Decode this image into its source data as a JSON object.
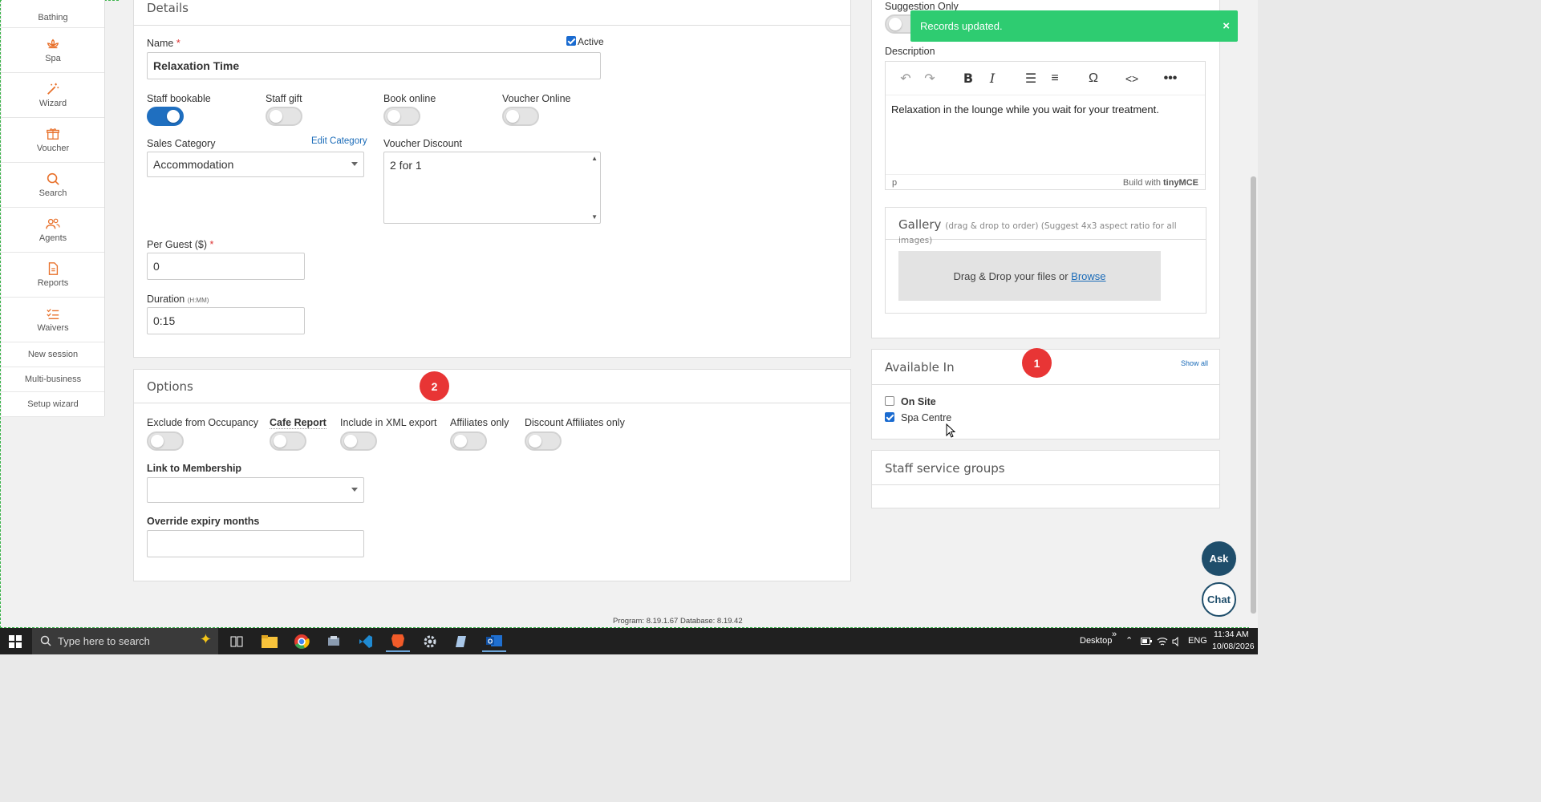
{
  "sidebar": {
    "items": [
      {
        "label": "Bathing",
        "icon": "bathing-icon"
      },
      {
        "label": "Spa",
        "icon": "lotus-icon"
      },
      {
        "label": "Wizard",
        "icon": "magic-wand-icon"
      },
      {
        "label": "Voucher",
        "icon": "gift-icon"
      },
      {
        "label": "Search",
        "icon": "search-icon"
      },
      {
        "label": "Agents",
        "icon": "users-icon"
      },
      {
        "label": "Reports",
        "icon": "document-icon"
      },
      {
        "label": "Waivers",
        "icon": "checklist-icon"
      }
    ],
    "links": [
      "New session",
      "Multi-business",
      "Setup wizard"
    ]
  },
  "details": {
    "title": "Details",
    "name_label": "Name",
    "required_mark": "*",
    "active_label": "Active",
    "active_checked": true,
    "name_value": "Relaxation Time",
    "toggles": [
      {
        "label": "Staff bookable",
        "on": true
      },
      {
        "label": "Staff gift",
        "on": false
      },
      {
        "label": "Book online",
        "on": false
      },
      {
        "label": "Voucher Online",
        "on": false
      }
    ],
    "sales_category_label": "Sales Category",
    "edit_category_label": "Edit Category",
    "sales_category_value": "Accommodation",
    "voucher_discount_label": "Voucher Discount",
    "voucher_discount_value": "2 for 1",
    "per_guest_label": "Per Guest ($)",
    "per_guest_value": "0",
    "duration_label": "Duration",
    "duration_hint": "(H:MM)",
    "duration_value": "0:15"
  },
  "options": {
    "title": "Options",
    "badge": "2",
    "toggles": [
      {
        "label": "Exclude from Occupancy",
        "on": false
      },
      {
        "label": "Cafe Report",
        "on": false
      },
      {
        "label": "Include in XML export",
        "on": false
      },
      {
        "label": "Affiliates only",
        "on": false
      },
      {
        "label": "Discount Affiliates only",
        "on": false
      }
    ],
    "membership_label": "Link to Membership",
    "membership_value": "",
    "expiry_label": "Override expiry months",
    "expiry_value": ""
  },
  "right": {
    "suggestion_label": "Suggestion Only",
    "toast": "Records updated.",
    "toast_close": "×",
    "description_label": "Description",
    "description_text": "Relaxation in the lounge while you wait for your treatment.",
    "editor_path": "p",
    "editor_brand": "Build with",
    "editor_brand_name": "tinyMCE",
    "gallery_title": "Gallery",
    "gallery_hint": "(drag & drop to order) (Suggest 4x3 aspect ratio for all images)",
    "dropzone_text": "Drag & Drop your files or",
    "browse_label": "Browse",
    "available_title": "Available In",
    "available_badge": "1",
    "show_all": "Show all",
    "locations": [
      {
        "label": "On Site",
        "checked": false,
        "bold": true
      },
      {
        "label": "Spa Centre",
        "checked": true,
        "bold": false
      }
    ],
    "staff_groups_title": "Staff service groups"
  },
  "footer": {
    "version": "Program: 8.19.1.67 Database: 8.19.42"
  },
  "fabs": {
    "ask": "Ask",
    "chat": "Chat"
  },
  "taskbar": {
    "search_placeholder": "Type here to search",
    "desktop_label": "Desktop",
    "language": "ENG",
    "time": "11:34 AM",
    "date": "10/08/2026"
  },
  "colors": {
    "primary": "#1f6fc0",
    "toast": "#2ecc71",
    "badge": "#e83535",
    "fab": "#1f4e6b"
  }
}
